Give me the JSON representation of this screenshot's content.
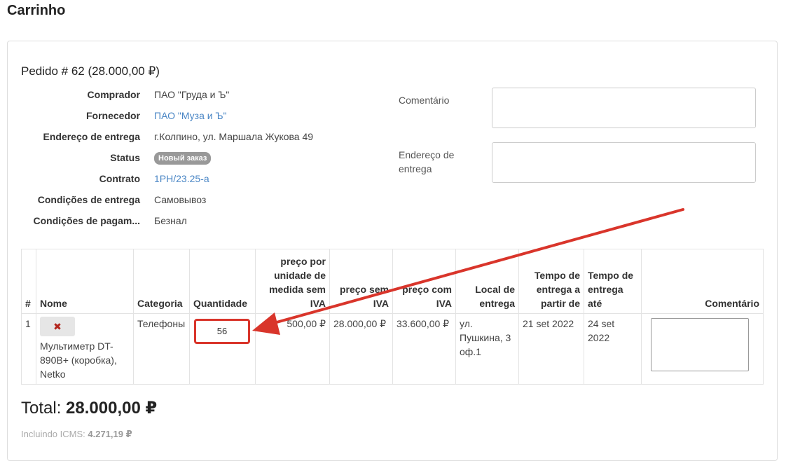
{
  "page": {
    "title": "Carrinho"
  },
  "order": {
    "title": "Pedido # 62 (28.000,00 ₽)",
    "fields": [
      {
        "label": "Comprador",
        "value": "ПАО \"Груда и Ъ\""
      },
      {
        "label": "Fornecedor",
        "value": "ПАО \"Муза и Ъ\""
      },
      {
        "label": "Endereço de entrega",
        "value": "г.Колпино, ул. Маршала Жукова 49"
      },
      {
        "label": "Status",
        "value": "Новый заказ"
      },
      {
        "label": "Contrato",
        "value": "1РН/23.25-а"
      },
      {
        "label": "Condições de entrega",
        "value": "Самовывоз"
      },
      {
        "label": "Condições de pagam...",
        "value": "Безнал"
      }
    ],
    "comment_label": "Comentário",
    "address_label": "Endereço de entrega"
  },
  "table": {
    "headers": [
      "#",
      "Nome",
      "Categoria",
      "Quantidade",
      "preço por unidade de medida sem IVA",
      "preço sem IVA",
      "preço com IVA",
      "Local de entrega",
      "Tempo de entrega a partir de",
      "Tempo de entrega até",
      "Comentário"
    ],
    "rows": [
      {
        "index": "1",
        "delete_label": "✖",
        "name": "Мультиметр DT-890B+ (коробка), Netko",
        "category": "Телефоны",
        "quantity": "56",
        "unit_price": "500,00 ₽",
        "price_no_vat": "28.000,00 ₽",
        "price_vat": "33.600,00 ₽",
        "location": "ул. Пушкина, 3 оф.1",
        "from": "21 set 2022",
        "to": "24 set 2022"
      }
    ]
  },
  "summary": {
    "total_label": "Total:",
    "total_value": "28.000,00 ₽",
    "icms_label": "Incluindo ICMS:",
    "icms_value": "4.271,19 ₽"
  },
  "colors": {
    "accent": "#4a86c5",
    "highlight": "#d9352b"
  }
}
